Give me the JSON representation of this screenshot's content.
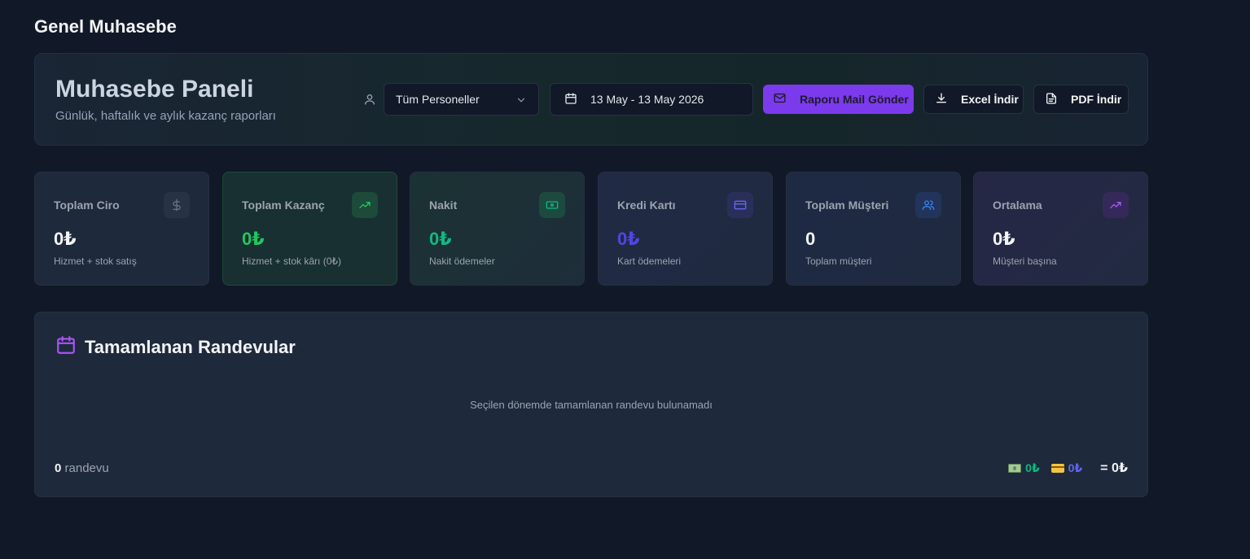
{
  "page": {
    "title": "Genel Muhasebe"
  },
  "header": {
    "title": "Muhasebe Paneli",
    "subtitle": "Günlük, haftalık ve aylık kazanç raporları",
    "staff_select": {
      "selected": "Tüm Personeller"
    },
    "date_range": "13 May - 13 May 2026",
    "buttons": {
      "mail": "Raporu Mail Gönder",
      "excel": "Excel İndir",
      "pdf": "PDF İndir"
    }
  },
  "stats": [
    {
      "label": "Toplam Ciro",
      "value": "0₺",
      "sub": "Hizmet + stok satış",
      "icon": "dollar-icon",
      "value_color": "#f3f4f6"
    },
    {
      "label": "Toplam Kazanç",
      "value": "0₺",
      "sub": "Hizmet + stok kârı (0₺)",
      "icon": "trending-up-icon",
      "value_color": "#22c55e"
    },
    {
      "label": "Nakit",
      "value": "0₺",
      "sub": "Nakit ödemeler",
      "icon": "banknote-icon",
      "value_color": "#10b981"
    },
    {
      "label": "Kredi Kartı",
      "value": "0₺",
      "sub": "Kart ödemeleri",
      "icon": "credit-card-icon",
      "value_color": "#4f46e5"
    },
    {
      "label": "Toplam Müşteri",
      "value": "0",
      "sub": "Toplam müşteri",
      "icon": "users-icon",
      "value_color": "#f3f4f6"
    },
    {
      "label": "Ortalama",
      "value": "0₺",
      "sub": "Müşteri başına",
      "icon": "trending-up-icon",
      "value_color": "#f3f4f6"
    }
  ],
  "appointments": {
    "title": "Tamamlanan Randevular",
    "empty_message": "Seçilen dönemde tamamlanan randevu bulunamadı",
    "count": "0",
    "count_label": "randevu",
    "cash_total": "0₺",
    "card_total": "0₺",
    "grand_total": "= 0₺"
  },
  "colors": {
    "accent": "#7c3aed",
    "green": "#22c55e",
    "teal": "#10b981",
    "indigo": "#4f46e5",
    "background": "#111827"
  }
}
